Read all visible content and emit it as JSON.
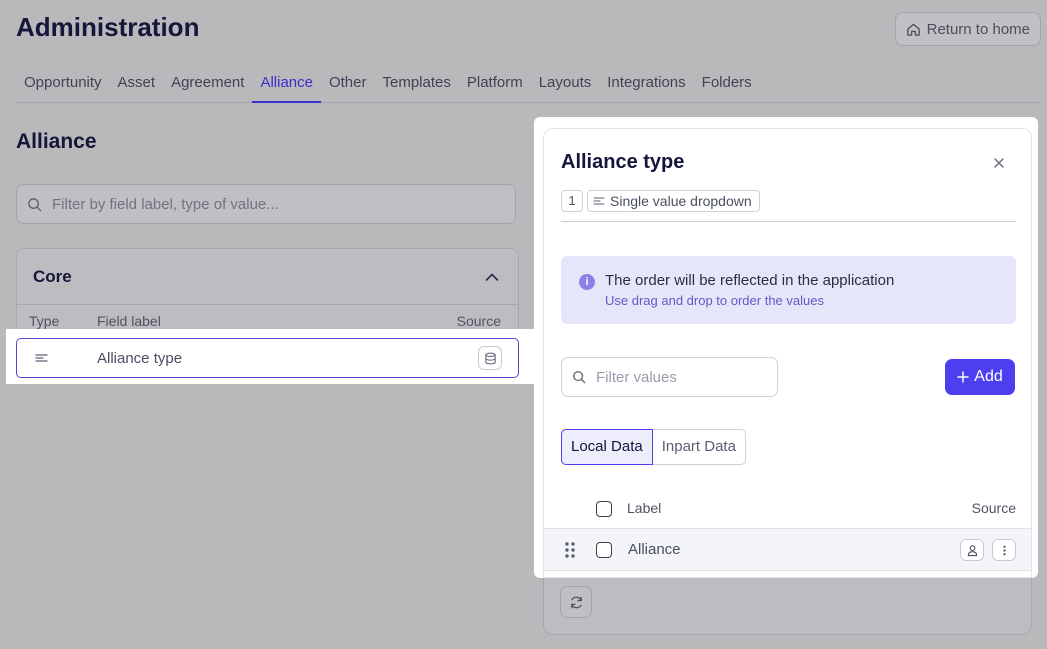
{
  "page": {
    "title": "Administration",
    "home_button": "Return to home"
  },
  "tabs": [
    {
      "label": "Opportunity",
      "active": false
    },
    {
      "label": "Asset",
      "active": false
    },
    {
      "label": "Agreement",
      "active": false
    },
    {
      "label": "Alliance",
      "active": true
    },
    {
      "label": "Other",
      "active": false
    },
    {
      "label": "Templates",
      "active": false
    },
    {
      "label": "Platform",
      "active": false
    },
    {
      "label": "Layouts",
      "active": false
    },
    {
      "label": "Integrations",
      "active": false
    },
    {
      "label": "Folders",
      "active": false
    }
  ],
  "section": {
    "title": "Alliance",
    "filter_placeholder": "Filter by field label, type of value..."
  },
  "core": {
    "title": "Core",
    "columns": {
      "type": "Type",
      "label": "Field label",
      "source": "Source"
    },
    "rows": [
      {
        "type_icon": "list-lines-icon",
        "label": "Alliance type",
        "source_icon": "database-icon"
      }
    ]
  },
  "modal": {
    "title": "Alliance type",
    "count": "1",
    "field_type": "Single value dropdown",
    "info": {
      "title": "The order will be reflected in the application",
      "subtitle": "Use drag and drop to order the values"
    },
    "filter_placeholder": "Filter values",
    "add_label": "Add",
    "segments": [
      {
        "label": "Local Data",
        "active": true
      },
      {
        "label": "Inpart Data",
        "active": false
      }
    ],
    "list": {
      "columns": {
        "label": "Label",
        "source": "Source"
      },
      "rows": [
        {
          "label": "Alliance",
          "source_icon": "user-icon"
        }
      ]
    }
  },
  "colors": {
    "accent": "#4b3ff0",
    "info_bg": "#e6e6fb",
    "overlay": "#b9b9bc"
  }
}
